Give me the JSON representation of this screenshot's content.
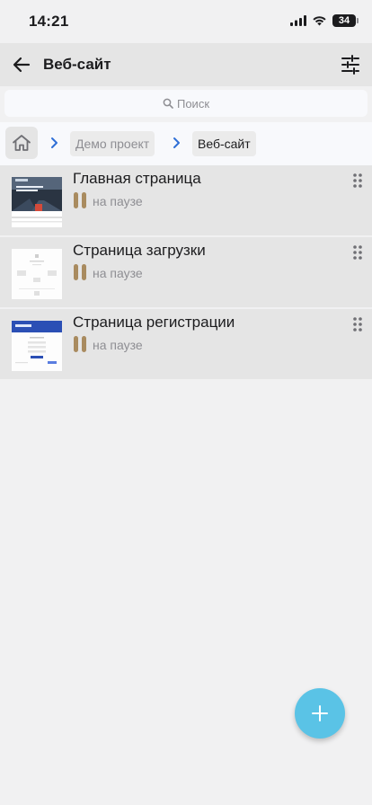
{
  "status_bar": {
    "time": "14:21",
    "battery": "34"
  },
  "header": {
    "title": "Веб-сайт",
    "back_icon": "arrow-left-icon",
    "filter_icon": "sliders-icon"
  },
  "search": {
    "placeholder": "Поиск",
    "icon": "search-icon"
  },
  "breadcrumb": {
    "home_icon": "home-icon",
    "items": [
      {
        "label": "Демо проект",
        "active": false
      },
      {
        "label": "Веб-сайт",
        "active": true
      }
    ]
  },
  "pages": [
    {
      "title": "Главная страница",
      "status": "на паузе",
      "status_icon": "pause-icon",
      "thumb": "dark-city-landing"
    },
    {
      "title": "Страница загрузки",
      "status": "на паузе",
      "status_icon": "pause-icon",
      "thumb": "white-download-page"
    },
    {
      "title": "Страница регистрации",
      "status": "на паузе",
      "status_icon": "pause-icon",
      "thumb": "blue-header-registration"
    }
  ],
  "fab": {
    "icon": "plus-icon"
  },
  "colors": {
    "fab": "#5ac3e6",
    "pause": "#a98b5f",
    "chevron": "#2f6fd6",
    "row_bg": "#e5e5e5"
  }
}
